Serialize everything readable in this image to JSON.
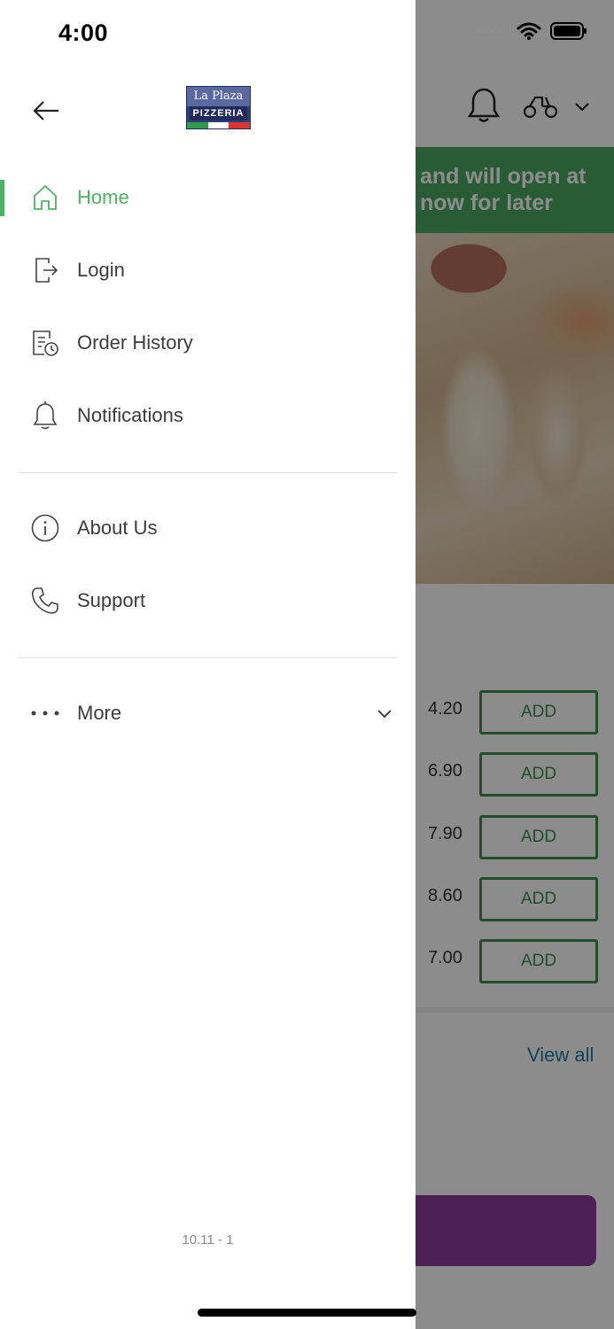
{
  "status_bar": {
    "time": "4:00"
  },
  "drawer": {
    "logo": {
      "line1": "La Plaza",
      "line2": "PIZZERIA"
    },
    "menu": [
      {
        "label": "Home",
        "icon": "home-icon",
        "active": true
      },
      {
        "label": "Login",
        "icon": "login-icon",
        "active": false
      },
      {
        "label": "Order History",
        "icon": "order-history-icon",
        "active": false
      },
      {
        "label": "Notifications",
        "icon": "bell-icon",
        "active": false
      },
      {
        "label": "About Us",
        "icon": "info-icon",
        "active": false
      },
      {
        "label": "Support",
        "icon": "phone-icon",
        "active": false
      },
      {
        "label": "More",
        "icon": "more-dots-icon",
        "active": false
      }
    ],
    "version": "10.11 - 1"
  },
  "background": {
    "banner_line1": "and will open at",
    "banner_line2": "now for later",
    "prices": [
      "4.20",
      "6.90",
      "7.90",
      "8.60",
      "7.00"
    ],
    "add_label": "ADD",
    "view_all": "View all"
  },
  "colors": {
    "accent": "#4db362",
    "banner": "#4aa85f",
    "add_border": "#3d8c52",
    "cart": "#8b3a9c"
  }
}
